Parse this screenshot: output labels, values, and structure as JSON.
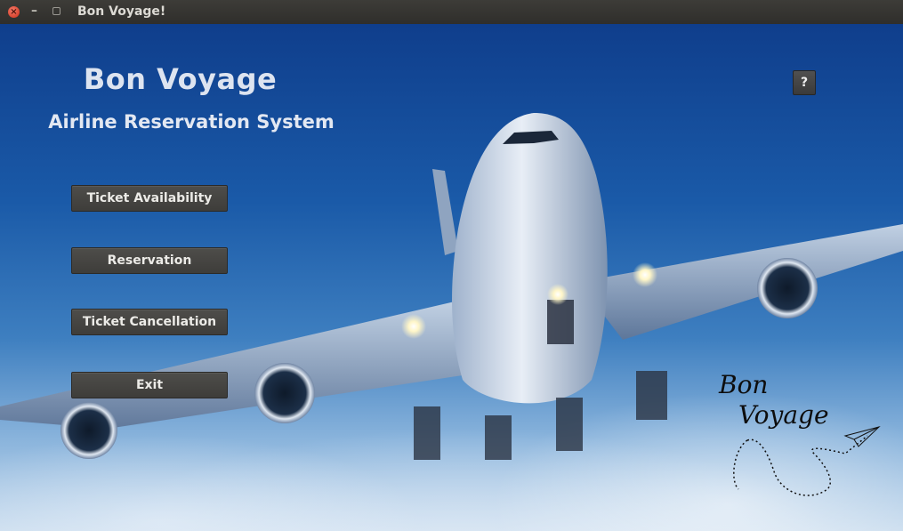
{
  "window": {
    "title": "Bon Voyage!"
  },
  "header": {
    "title": "Bon Voyage",
    "subtitle": "Airline Reservation System"
  },
  "menu": {
    "ticket_availability": "Ticket Availability",
    "reservation": "Reservation",
    "ticket_cancellation": "Ticket Cancellation",
    "exit": "Exit"
  },
  "help": {
    "label": "?"
  },
  "logo": {
    "line1": "Bon",
    "line2": "Voyage"
  },
  "icons": {
    "close": "close-icon",
    "minimize": "minimize-icon",
    "maximize": "maximize-icon",
    "help": "help-icon",
    "paper-plane": "paper-plane-icon"
  }
}
